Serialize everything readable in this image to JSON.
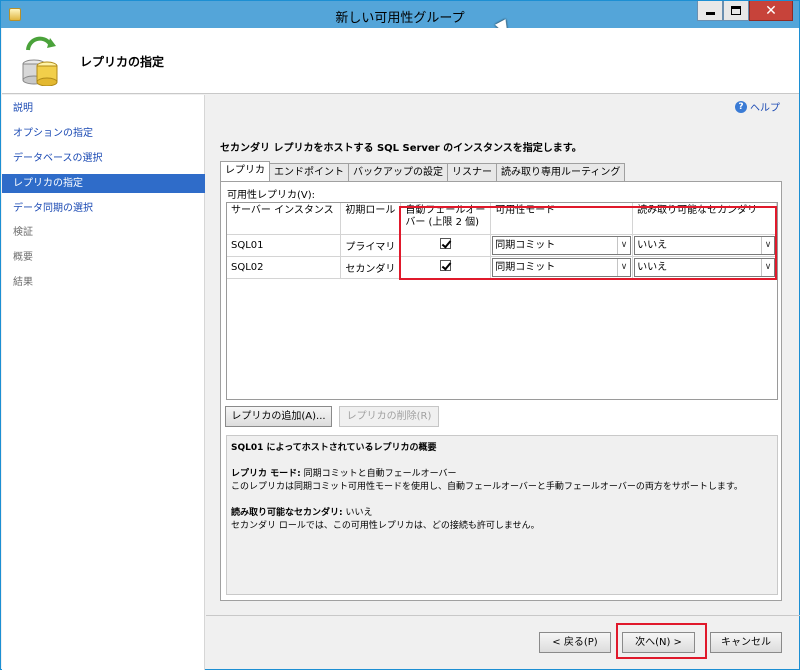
{
  "window": {
    "title": "新しい可用性グループ"
  },
  "header": {
    "title": "レプリカの指定"
  },
  "nav": {
    "items": [
      {
        "label": "説明",
        "state": "link"
      },
      {
        "label": "オプションの指定",
        "state": "link"
      },
      {
        "label": "データベースの選択",
        "state": "link"
      },
      {
        "label": "レプリカの指定",
        "state": "active"
      },
      {
        "label": "データ同期の選択",
        "state": "link"
      },
      {
        "label": "検証",
        "state": "disabled"
      },
      {
        "label": "概要",
        "state": "disabled"
      },
      {
        "label": "結果",
        "state": "disabled"
      }
    ]
  },
  "help": {
    "label": "ヘルプ"
  },
  "instruction": "セカンダリ レプリカをホストする SQL Server のインスタンスを指定します。",
  "tabs": [
    "レプリカ",
    "エンドポイント",
    "バックアップの設定",
    "リスナー",
    "読み取り専用ルーティング"
  ],
  "replicas": {
    "label": "可用性レプリカ(V):",
    "columns": [
      "サーバー インスタンス",
      "初期ロール",
      "自動フェールオーバー (上限 2 個)",
      "可用性モード",
      "読み取り可能なセカンダリ"
    ],
    "rows": [
      {
        "server": "SQL01",
        "role": "プライマリ",
        "auto_failover": true,
        "mode": "同期コミット",
        "readable": "いいえ"
      },
      {
        "server": "SQL02",
        "role": "セカンダリ",
        "auto_failover": true,
        "mode": "同期コミット",
        "readable": "いいえ"
      }
    ]
  },
  "buttons": {
    "add_replica": "レプリカの追加(A)...",
    "remove_replica": "レプリカの削除(R)",
    "back": "< 戻る(P)",
    "next": "次へ(N) >",
    "cancel": "キャンセル"
  },
  "summary": {
    "title": "SQL01 によってホストされているレプリカの概要",
    "mode_heading": "レプリカ モード:",
    "mode_value": "同期コミットと自動フェールオーバー",
    "mode_desc": "このレプリカは同期コミット可用性モードを使用し、自動フェールオーバーと手動フェールオーバーの両方をサポートします。",
    "readable_heading": "読み取り可能なセカンダリ:",
    "readable_value": "いいえ",
    "readable_desc": "セカンダリ ロールでは、この可用性レプリカは、どの接続も許可しません。"
  },
  "colors": {
    "titlebar": "#54a5d9",
    "nav_active": "#2f6cc9",
    "highlight": "#e0192b",
    "link": "#1a49b3"
  }
}
